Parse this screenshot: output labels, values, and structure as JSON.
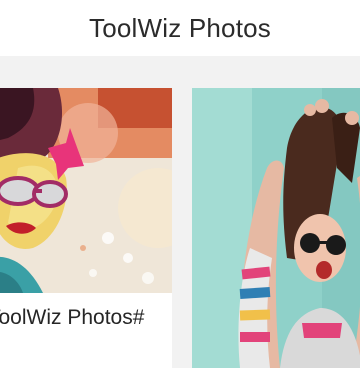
{
  "header": {
    "title": "ToolWiz Photos"
  },
  "cards": [
    {
      "caption": "ToolWiz Photos#",
      "thumbnail": "watercolor-portrait-woman-pink-sunglasses"
    },
    {
      "thumbnail": "painted-woman-hands-in-hair-sunglasses"
    }
  ],
  "colors": {
    "header_bg": "#ffffff",
    "page_bg": "#f2f2f2",
    "title": "#2b2b2b"
  }
}
